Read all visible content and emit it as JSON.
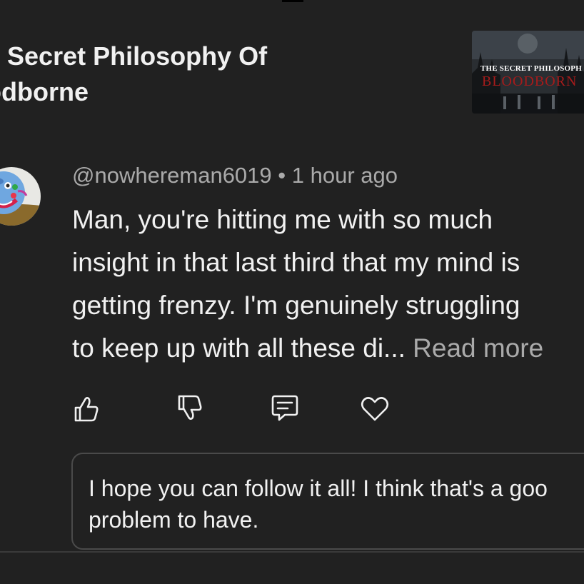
{
  "video": {
    "title": "e Secret Philosophy Of\nodborne",
    "thumbnail": {
      "text_line1": "THE SECRET PHILOSOPH",
      "text_line2": "BLOODBORN",
      "accent_color": "#a61b1b"
    }
  },
  "comment": {
    "author": "@nowhereman6019",
    "separator": " • ",
    "time": "1 hour ago",
    "body": "Man, you're hitting me with so much\ninsight in that last third that my mind is\ngetting frenzy. I'm genuinely struggling\nto keep up with all these di... ",
    "read_more": "Read more",
    "avatar_icon": "clown-face-avatar"
  },
  "actions": {
    "like_icon": "thumbs-up-icon",
    "dislike_icon": "thumbs-down-icon",
    "reply_icon": "comment-bubble-icon",
    "heart_icon": "heart-icon"
  },
  "reply": {
    "text": "I hope you can follow it all! I think that's a goo\nproblem to have."
  },
  "colors": {
    "background": "#212121",
    "text_primary": "#f1f1f1",
    "text_secondary": "#aaaaaa",
    "border": "#4a4a4a"
  }
}
